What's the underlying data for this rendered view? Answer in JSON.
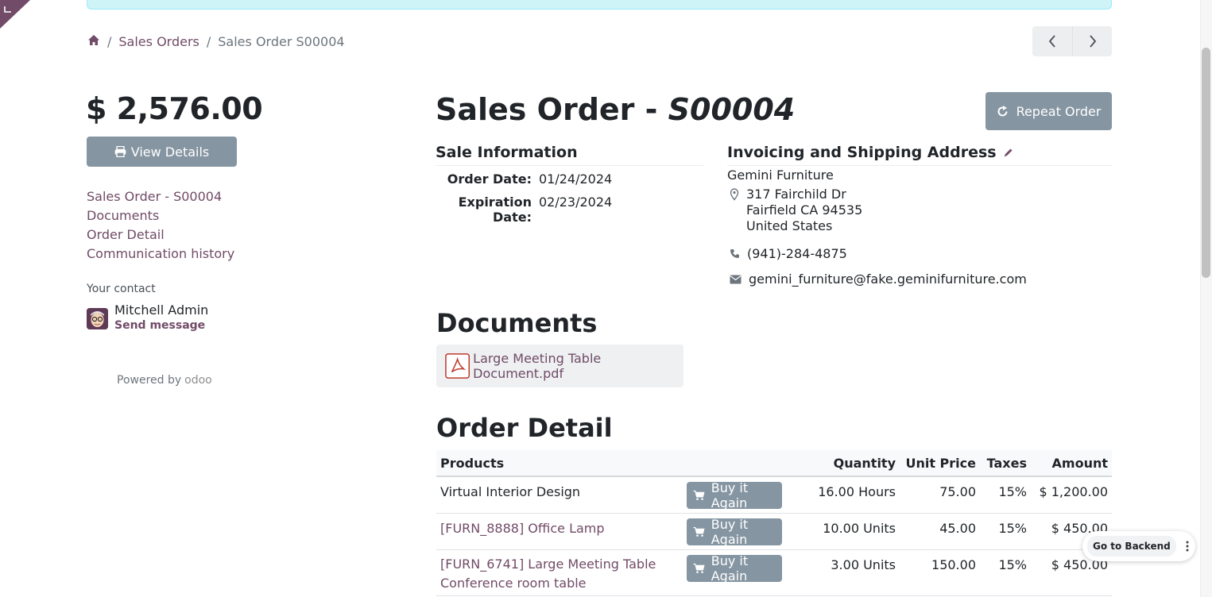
{
  "breadcrumb": {
    "sep": "/",
    "items": [
      "Sales Orders",
      "Sales Order S00004"
    ]
  },
  "sidebar": {
    "amount": "$ 2,576.00",
    "view_details": "View Details",
    "nav": [
      "Sales Order - S00004",
      "Documents",
      "Order Detail",
      "Communication history"
    ],
    "your_contact": "Your contact",
    "contact_name": "Mitchell Admin",
    "send_message": "Send message",
    "powered_by": "Powered by",
    "odoo": "odoo"
  },
  "order": {
    "title_prefix": "Sales Order - ",
    "title_ref": "S00004",
    "repeat_order": "Repeat Order",
    "sale_info_heading": "Sale Information",
    "order_date_label": "Order Date:",
    "order_date": "01/24/2024",
    "expiration_label": "Expiration Date:",
    "expiration_date": "02/23/2024",
    "address_heading": "Invoicing and Shipping Address",
    "partner_name": "Gemini Furniture",
    "address_lines": [
      "317 Fairchild Dr",
      "Fairfield CA 94535",
      "United States"
    ],
    "phone": "(941)-284-4875",
    "email": "gemini_furniture@fake.geminifurniture.com"
  },
  "documents": {
    "heading": "Documents",
    "file": "Large Meeting Table Document.pdf"
  },
  "order_detail": {
    "heading": "Order Detail",
    "columns": [
      "Products",
      "Quantity",
      "Unit Price",
      "Taxes",
      "Amount"
    ],
    "buy_again": "Buy it Again",
    "rows": [
      {
        "product": "Virtual Interior Design",
        "desc": "",
        "qty": "16.00 Hours",
        "price": "75.00",
        "tax": "15%",
        "amount": "$ 1,200.00"
      },
      {
        "product": "[FURN_8888] Office Lamp",
        "desc": "",
        "qty": "10.00 Units",
        "price": "45.00",
        "tax": "15%",
        "amount": "$ 450.00"
      },
      {
        "product": "[FURN_6741] Large Meeting Table",
        "desc": "Conference room table",
        "qty": "3.00 Units",
        "price": "150.00",
        "tax": "15%",
        "amount": "$ 450.00"
      }
    ]
  },
  "floating": {
    "go_backend": "Go to Backend"
  },
  "colors": {
    "primary": "#714B67",
    "secondary_button": "#8595a2"
  }
}
